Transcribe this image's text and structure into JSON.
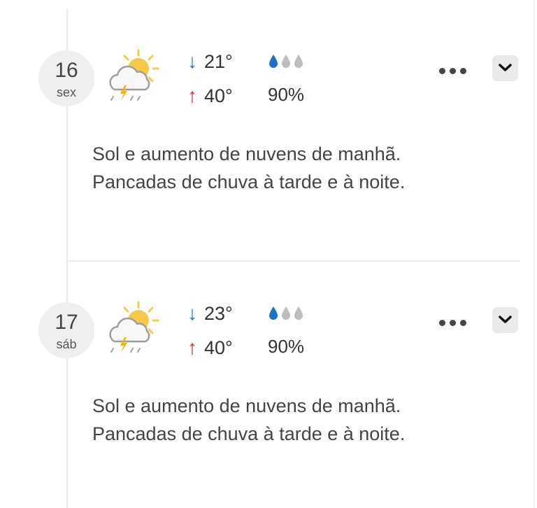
{
  "forecast": {
    "days": [
      {
        "date": "16",
        "weekday": "sex",
        "icon": "sun-cloud-thunder-icon",
        "low": "21°",
        "high": "40°",
        "precip": "90%",
        "drops_filled": 1,
        "drops_total": 3,
        "description": "Sol e aumento de nuvens de manhã. Pancadas de chuva à tarde e à noite."
      },
      {
        "date": "17",
        "weekday": "sáb",
        "icon": "sun-cloud-thunder-icon",
        "low": "23°",
        "high": "40°",
        "precip": "90%",
        "drops_filled": 1,
        "drops_total": 3,
        "description": "Sol e aumento de nuvens de manhã. Pancadas de chuva à tarde e à noite."
      }
    ]
  },
  "icons": {
    "low_arrow": "↓",
    "high_arrow": "↑",
    "more": "more-options-icon",
    "expand": "chevron-down-icon"
  },
  "colors": {
    "low_arrow": "#1a73c7",
    "high_arrow": "#c62828",
    "drop_active": "#1a73c7",
    "drop_inactive": "#bdbdbd",
    "sun": "#f7c948",
    "lightning": "#f2b705"
  }
}
